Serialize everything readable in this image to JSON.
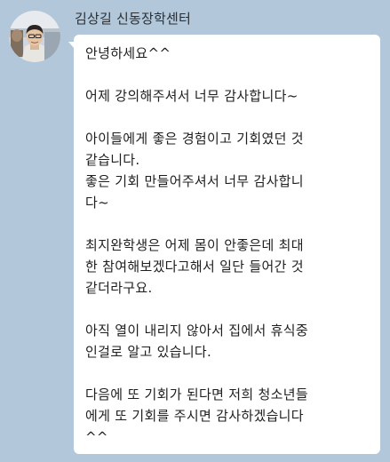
{
  "sender": {
    "name": "김상길 신동장학센터",
    "avatar_icon": "profile-photo-avatar"
  },
  "message": {
    "paragraphs": [
      "안녕하세요^^",
      "어제 강의해주셔서 너무 감사합니다~",
      "아이들에게 좋은 경험이고 기회였던 것\n같습니다.\n좋은 기회 만들어주셔서 너무 감사합니\n다~",
      "최지완학생은 어제 몸이 안좋은데 최대\n한 참여해보겠다고해서 일단 들어간 것\n같더라구요.",
      "아직 열이 내리지 않아서 집에서 휴식중\n인걸로 알고 있습니다.",
      "다음에 또 기회가 된다면 저희 청소년들\n에게 또 기회를 주시면 감사하겠습니다\n^^"
    ]
  },
  "colors": {
    "background": "#b2c7da",
    "bubble": "#ffffff",
    "text": "#1e1e1e"
  }
}
